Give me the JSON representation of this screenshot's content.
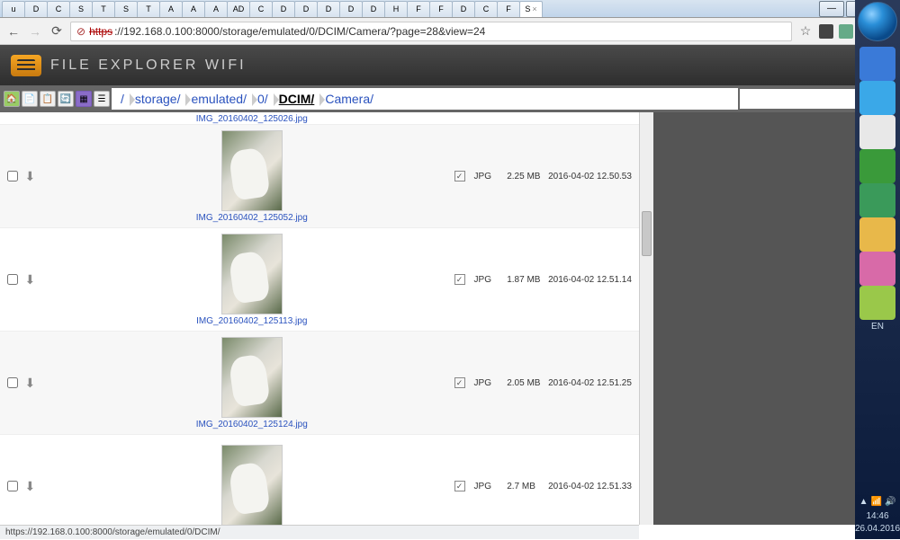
{
  "browser": {
    "url_proto": "https",
    "url_rest": "://192.168.0.100:8000/storage/emulated/0/DCIM/Camera/?page=28&view=24",
    "tabs": [
      "u",
      "D",
      "C",
      "S",
      "T",
      "S",
      "T",
      "A",
      "A",
      "A",
      "AD",
      "C",
      "D",
      "D",
      "D",
      "D",
      "D",
      "H",
      "F",
      "F",
      "D",
      "C",
      "F",
      "S"
    ],
    "active_tab": 23
  },
  "app": {
    "title": "FILE EXPLORER WIFI",
    "help": "?"
  },
  "breadcrumbs": [
    "/",
    "storage/",
    "emulated/",
    "0/",
    "DCIM/",
    "Camera/"
  ],
  "breadcrumb_current_index": 4,
  "search": {
    "placeholder": ""
  },
  "files": [
    {
      "name": "IMG_20160402_125026.jpg",
      "ext": "",
      "size": "",
      "date": "",
      "partial": true
    },
    {
      "name": "IMG_20160402_125052.jpg",
      "ext": "JPG",
      "size": "2.25 MB",
      "date": "2016-04-02 12.50.53"
    },
    {
      "name": "IMG_20160402_125113.jpg",
      "ext": "JPG",
      "size": "1.87 MB",
      "date": "2016-04-02 12.51.14"
    },
    {
      "name": "IMG_20160402_125124.jpg",
      "ext": "JPG",
      "size": "2.05 MB",
      "date": "2016-04-02 12.51.25"
    },
    {
      "name": "",
      "ext": "JPG",
      "size": "2.7 MB",
      "date": "2016-04-02 12.51.33"
    }
  ],
  "status_text": "https://192.168.0.100:8000/storage/emulated/0/DCIM/",
  "system": {
    "lang": "EN",
    "time": "14:46",
    "date": "26.04.2016"
  },
  "side_colors": [
    "#3a7ad8",
    "#3aa8e8",
    "#e8e8e8",
    "#3a9a3a",
    "#3a9a5a",
    "#e8b84a",
    "#d86aa8",
    "#9ac84a"
  ]
}
